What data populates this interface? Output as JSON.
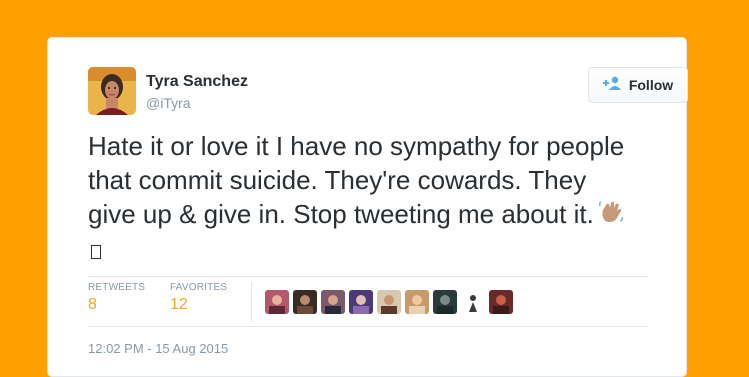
{
  "tweet": {
    "author_name": "Tyra Sanchez",
    "author_handle": "@iTyra",
    "follow_label": "Follow",
    "text": "Hate it or love it I have no sympathy for people that commit suicide. They're cowards. They give up & give in. Stop tweeting me about it.",
    "emoji": [
      "waving-hand-icon",
      "missing-glyph-icon"
    ],
    "stats": {
      "retweets_label": "RETWEETS",
      "retweets_value": "8",
      "favorites_label": "FAVORITES",
      "favorites_value": "12"
    },
    "favoriters_avatars": [
      "avatar-1",
      "avatar-2",
      "avatar-3",
      "avatar-4",
      "avatar-5",
      "avatar-6",
      "avatar-7",
      "avatar-8",
      "avatar-9"
    ],
    "timestamp": "12:02 PM - 15 Aug 2015"
  },
  "colors": {
    "page_background": "#FFA000",
    "card_background": "#FFFFFF",
    "stat_value": "#F5A623",
    "muted_text": "#8899A6",
    "follow_icon": "#55ACEE"
  }
}
